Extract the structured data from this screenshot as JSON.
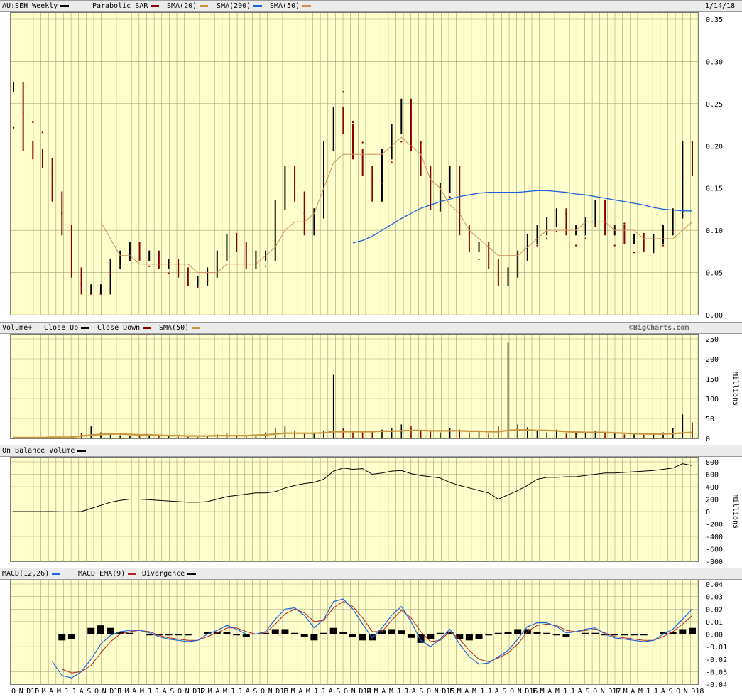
{
  "price_header": {
    "symbol": "AU:SEH Weekly",
    "psar_label": "Parabolic SAR",
    "sma20_label": "SMA(20)",
    "sma200_label": "SMA(200)",
    "sma50_label": "SMA(50)",
    "date": "1/14/18",
    "credit": "©BigCharts.com"
  },
  "volume_header": {
    "label": "Volume+",
    "close_up": "Close Up",
    "close_down": "Close Down",
    "sma_label": "SMA(50)",
    "unit": "Millions"
  },
  "obv_header": {
    "label": "On Balance Volume",
    "unit": "Millions"
  },
  "macd_header": {
    "label": "MACD(12,26)",
    "ema_label": "MACD EMA(9)",
    "div_label": "Divergence"
  },
  "colors": {
    "up": "#000000",
    "down": "#8b0000",
    "sma20": "#8b0000",
    "sma200": "#1e64dc",
    "sma50": "#d28c5a",
    "vol_sma": "#c89640",
    "macd": "#1e64dc",
    "macd_ema": "#b22222",
    "panel_bg": "#ffffcc",
    "grid": "#a0a078"
  },
  "x_axis_labels": [
    "O",
    "N",
    "D10",
    "F",
    "M",
    "A",
    "M",
    "J",
    "J",
    "A",
    "S",
    "O",
    "N",
    "D11",
    "F",
    "M",
    "A",
    "M",
    "J",
    "J",
    "A",
    "S",
    "O",
    "N",
    "D12",
    "F",
    "M",
    "A",
    "M",
    "J",
    "J",
    "A",
    "S",
    "O",
    "N",
    "D13",
    "F",
    "M",
    "A",
    "M",
    "J",
    "J",
    "A",
    "S",
    "O",
    "N",
    "D14",
    "F",
    "M",
    "A",
    "M",
    "J",
    "J",
    "A",
    "S",
    "O",
    "N",
    "D15",
    "F",
    "M",
    "A",
    "M",
    "J",
    "J",
    "A",
    "S",
    "O",
    "N",
    "D16",
    "F",
    "M",
    "A",
    "M",
    "J",
    "J",
    "A",
    "S",
    "O",
    "N",
    "D17",
    "F",
    "M",
    "A",
    "M",
    "J",
    "J",
    "A",
    "S",
    "O",
    "N",
    "D18"
  ],
  "chart_data": [
    {
      "type": "line",
      "title": "AU:SEH Weekly",
      "ylim": [
        0,
        0.35
      ],
      "y_ticks": [
        "0.35",
        "0.30",
        "0.25",
        "0.20",
        "0.15",
        "0.10",
        "0.05",
        "0.00"
      ],
      "series": [
        {
          "name": "AU:SEH Weekly",
          "values": [
            0.27,
            0.2,
            0.19,
            0.18,
            0.14,
            0.1,
            0.05,
            0.03,
            0.03,
            0.03,
            0.06,
            0.07,
            0.08,
            0.07,
            0.07,
            0.06,
            0.06,
            0.05,
            0.04,
            0.04,
            0.05,
            0.07,
            0.09,
            0.08,
            0.06,
            0.07,
            0.07,
            0.13,
            0.17,
            0.14,
            0.1,
            0.12,
            0.2,
            0.24,
            0.22,
            0.19,
            0.17,
            0.14,
            0.19,
            0.22,
            0.25,
            0.2,
            0.17,
            0.13,
            0.15,
            0.17,
            0.1,
            0.08,
            0.08,
            0.06,
            0.04,
            0.05,
            0.07,
            0.09,
            0.1,
            0.11,
            0.12,
            0.1,
            0.1,
            0.11,
            0.13,
            0.1,
            0.1,
            0.09,
            0.09,
            0.08,
            0.09,
            0.1,
            0.12,
            0.2,
            0.17
          ]
        },
        {
          "name": "SMA(50)",
          "values": [
            null,
            null,
            null,
            null,
            null,
            null,
            null,
            null,
            null,
            0.11,
            0.09,
            0.07,
            0.07,
            0.06,
            0.06,
            0.06,
            0.06,
            0.06,
            0.06,
            0.05,
            0.05,
            0.05,
            0.06,
            0.06,
            0.06,
            0.06,
            0.07,
            0.08,
            0.1,
            0.11,
            0.11,
            0.12,
            0.15,
            0.18,
            0.19,
            0.19,
            0.19,
            0.19,
            0.19,
            0.2,
            0.21,
            0.2,
            0.19,
            0.16,
            0.15,
            0.13,
            0.12,
            0.1,
            0.09,
            0.08,
            0.07,
            0.07,
            0.07,
            0.08,
            0.09,
            0.1,
            0.1,
            0.1,
            0.1,
            0.11,
            0.11,
            0.11,
            0.1,
            0.1,
            0.1,
            0.09,
            0.09,
            0.09,
            0.09,
            0.1,
            0.11
          ]
        },
        {
          "name": "SMA(200)",
          "values": [
            null,
            null,
            null,
            null,
            null,
            null,
            null,
            null,
            null,
            null,
            null,
            null,
            null,
            null,
            null,
            null,
            null,
            null,
            null,
            null,
            null,
            null,
            null,
            null,
            null,
            null,
            null,
            null,
            null,
            null,
            null,
            null,
            null,
            null,
            null,
            0.085,
            0.088,
            0.093,
            0.1,
            0.107,
            0.114,
            0.12,
            0.126,
            0.13,
            0.134,
            0.137,
            0.14,
            0.142,
            0.144,
            0.145,
            0.145,
            0.145,
            0.145,
            0.146,
            0.147,
            0.147,
            0.146,
            0.145,
            0.143,
            0.142,
            0.14,
            0.138,
            0.136,
            0.134,
            0.132,
            0.13,
            0.127,
            0.125,
            0.124,
            0.123,
            0.123
          ]
        }
      ]
    },
    {
      "type": "bar",
      "title": "Volume+",
      "ylabel": "Millions",
      "ylim": [
        0,
        250
      ],
      "y_ticks": [
        "250",
        "200",
        "150",
        "100",
        "50",
        "0"
      ],
      "series": [
        {
          "name": "Volume+",
          "values": [
            2,
            2,
            3,
            2,
            3,
            2,
            5,
            14,
            30,
            15,
            10,
            8,
            6,
            8,
            6,
            5,
            5,
            4,
            4,
            3,
            8,
            10,
            12,
            8,
            5,
            10,
            15,
            25,
            30,
            20,
            12,
            12,
            20,
            160,
            25,
            15,
            18,
            18,
            22,
            25,
            35,
            30,
            20,
            18,
            15,
            25,
            22,
            15,
            20,
            12,
            30,
            240,
            35,
            28,
            18,
            15,
            22,
            12,
            15,
            14,
            18,
            16,
            12,
            10,
            10,
            9,
            12,
            15,
            25,
            60,
            40
          ]
        },
        {
          "name": "SMA(50)",
          "values": [
            2,
            2,
            2,
            2,
            3,
            3,
            3,
            6,
            8,
            10,
            11,
            11,
            10,
            9,
            9,
            8,
            7,
            7,
            6,
            6,
            6,
            7,
            7,
            7,
            7,
            8,
            9,
            11,
            13,
            13,
            13,
            13,
            14,
            17,
            17,
            17,
            17,
            17,
            18,
            18,
            19,
            20,
            20,
            19,
            19,
            19,
            19,
            18,
            18,
            17,
            17,
            20,
            21,
            21,
            20,
            20,
            19,
            17,
            16,
            15,
            15,
            15,
            14,
            13,
            12,
            11,
            11,
            11,
            12,
            14,
            15
          ]
        }
      ]
    },
    {
      "type": "line",
      "title": "On Balance Volume",
      "ylabel": "Millions",
      "ylim": [
        -800,
        800
      ],
      "y_ticks": [
        "800",
        "600",
        "400",
        "200",
        "0",
        "-200",
        "-400",
        "-600",
        "-800"
      ],
      "series": [
        {
          "name": "On Balance Volume",
          "values": [
            0,
            0,
            0,
            0,
            0,
            -5,
            -5,
            0,
            50,
            100,
            150,
            180,
            200,
            200,
            190,
            180,
            170,
            160,
            150,
            150,
            160,
            200,
            240,
            260,
            280,
            300,
            300,
            320,
            380,
            420,
            450,
            470,
            520,
            650,
            700,
            680,
            690,
            600,
            620,
            650,
            660,
            610,
            580,
            560,
            540,
            470,
            420,
            380,
            340,
            300,
            200,
            270,
            340,
            420,
            520,
            550,
            550,
            560,
            560,
            580,
            600,
            620,
            620,
            630,
            640,
            650,
            660,
            680,
            700,
            770,
            740
          ]
        }
      ]
    },
    {
      "type": "line",
      "title": "MACD(12,26)",
      "ylim": [
        -0.04,
        0.04
      ],
      "y_ticks": [
        "0.04",
        "0.03",
        "0.02",
        "0.01",
        "0.00",
        "-0.01",
        "-0.02",
        "-0.03",
        "-0.04"
      ],
      "series": [
        {
          "name": "MACD(12,26)",
          "values": [
            null,
            null,
            null,
            null,
            -0.022,
            -0.033,
            -0.035,
            -0.03,
            -0.02,
            -0.008,
            -0.001,
            0.002,
            0.003,
            0.003,
            0.001,
            -0.002,
            -0.004,
            -0.005,
            -0.006,
            -0.005,
            0.0,
            0.003,
            0.007,
            0.004,
            0.0,
            0.0,
            0.002,
            0.012,
            0.02,
            0.021,
            0.015,
            0.005,
            0.012,
            0.026,
            0.028,
            0.02,
            0.008,
            -0.003,
            0.005,
            0.015,
            0.022,
            0.01,
            -0.005,
            -0.01,
            -0.004,
            0.004,
            -0.008,
            -0.018,
            -0.024,
            -0.023,
            -0.018,
            -0.013,
            -0.004,
            0.006,
            0.009,
            0.009,
            0.006,
            0.001,
            0.002,
            0.004,
            0.005,
            0.0,
            -0.003,
            -0.004,
            -0.005,
            -0.006,
            -0.005,
            0.0,
            0.004,
            0.012,
            0.02
          ]
        },
        {
          "name": "MACD EMA(9)",
          "values": [
            null,
            null,
            null,
            null,
            null,
            -0.028,
            -0.031,
            -0.03,
            -0.025,
            -0.015,
            -0.006,
            0.0,
            0.002,
            0.003,
            0.002,
            -0.001,
            -0.003,
            -0.004,
            -0.005,
            -0.005,
            -0.002,
            0.001,
            0.005,
            0.005,
            0.002,
            0.0,
            0.001,
            0.008,
            0.016,
            0.02,
            0.017,
            0.01,
            0.011,
            0.021,
            0.026,
            0.022,
            0.013,
            0.002,
            0.002,
            0.011,
            0.019,
            0.013,
            0.002,
            -0.006,
            -0.005,
            0.002,
            -0.004,
            -0.013,
            -0.02,
            -0.022,
            -0.019,
            -0.015,
            -0.008,
            0.002,
            0.007,
            0.008,
            0.007,
            0.003,
            0.002,
            0.003,
            0.004,
            0.001,
            -0.002,
            -0.003,
            -0.004,
            -0.005,
            -0.005,
            -0.002,
            0.002,
            0.008,
            0.015
          ]
        },
        {
          "name": "Divergence",
          "values": [
            null,
            null,
            null,
            null,
            null,
            -0.005,
            -0.004,
            0.0,
            0.005,
            0.007,
            0.005,
            0.002,
            0.001,
            0.0,
            -0.001,
            -0.001,
            -0.001,
            -0.001,
            -0.001,
            0.0,
            0.002,
            0.002,
            0.002,
            -0.001,
            -0.002,
            0.0,
            0.001,
            0.004,
            0.004,
            0.001,
            -0.002,
            -0.005,
            0.001,
            0.005,
            0.002,
            -0.002,
            -0.005,
            -0.005,
            0.003,
            0.004,
            0.003,
            -0.003,
            -0.007,
            -0.004,
            0.001,
            0.002,
            -0.004,
            -0.005,
            -0.004,
            -0.001,
            0.001,
            0.002,
            0.004,
            0.004,
            0.002,
            0.001,
            -0.001,
            -0.002,
            0.0,
            0.001,
            0.001,
            -0.001,
            -0.001,
            -0.001,
            -0.001,
            -0.001,
            0.0,
            0.002,
            0.002,
            0.004,
            0.005
          ]
        }
      ]
    }
  ]
}
